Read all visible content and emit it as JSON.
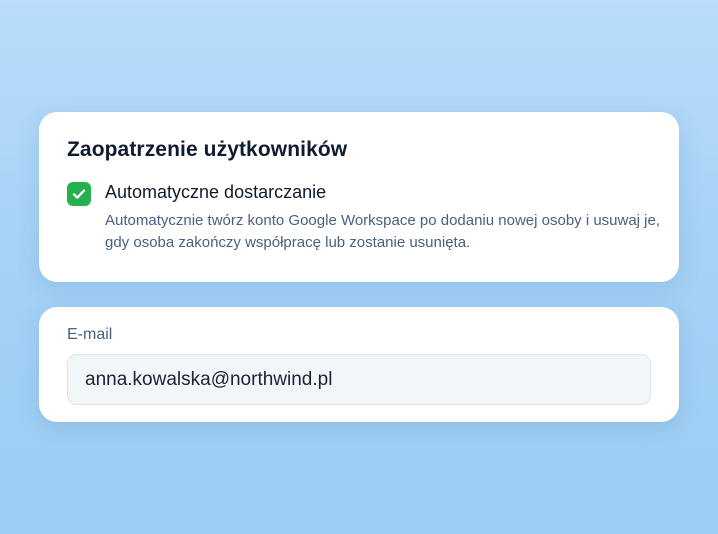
{
  "provisioning": {
    "title": "Zaopatrzenie użytkowników",
    "checkbox": {
      "checked": true,
      "label": "Automatyczne dostarczanie",
      "description": "Automatycznie twórz konto Google Workspace po dodaniu nowej osoby i usuwaj je, gdy osoba zakończy współpracę lub zostanie usunięta."
    }
  },
  "email": {
    "label": "E-mail",
    "value": "anna.kowalska@northwind.pl"
  },
  "colors": {
    "checkbox_accent": "#22b14c",
    "background": "#a6d2f6"
  }
}
